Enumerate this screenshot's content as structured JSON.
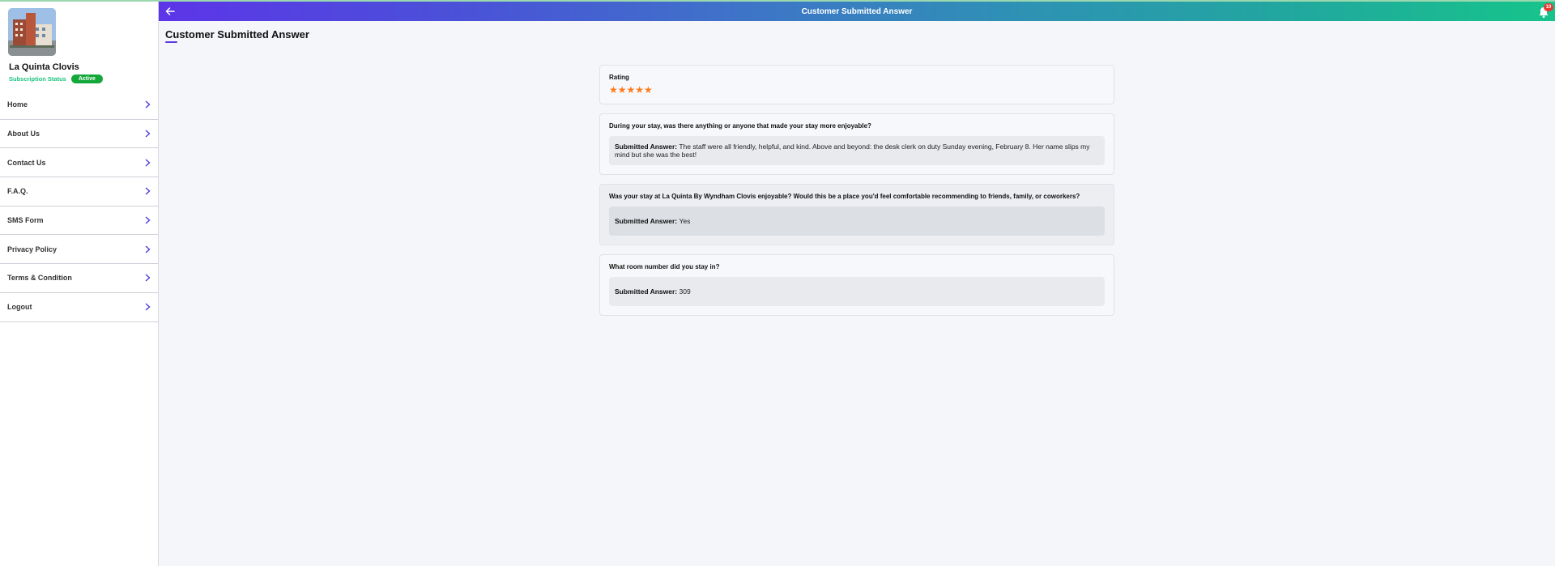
{
  "sidebar": {
    "hotel_name": "La Quinta Clovis",
    "subscription_label": "Subscription Status",
    "subscription_status": "Active",
    "items": [
      {
        "label": "Home"
      },
      {
        "label": "About Us"
      },
      {
        "label": "Contact Us"
      },
      {
        "label": "F.A.Q."
      },
      {
        "label": "SMS Form"
      },
      {
        "label": "Privacy Policy"
      },
      {
        "label": "Terms & Condition"
      },
      {
        "label": "Logout"
      }
    ]
  },
  "header": {
    "title": "Customer Submitted Answer",
    "notification_count": "10"
  },
  "page": {
    "title": "Customer Submitted Answer"
  },
  "rating": {
    "label": "Rating",
    "stars": "★★★★★",
    "value": 5,
    "max": 5
  },
  "questions": [
    {
      "question": "During your stay, was there anything or anyone that made your stay more enjoyable?",
      "answer_label": "Submitted Answer:",
      "answer": "The staff were all friendly, helpful, and kind. Above and beyond: the desk clerk on duty Sunday evening, February 8. Her name slips my mind but she was the best!"
    },
    {
      "question": "Was your stay at La Quinta By Wyndham Clovis enjoyable? Would this be a place you'd feel comfortable recommending to friends, family, or coworkers?",
      "answer_label": "Submitted Answer:",
      "answer": "Yes"
    },
    {
      "question": "What room number did you stay in?",
      "answer_label": "Submitted Answer:",
      "answer": "309"
    }
  ],
  "colors": {
    "accent": "#5b3be0",
    "status_green": "#14a83b",
    "star": "#ff7a1a"
  }
}
